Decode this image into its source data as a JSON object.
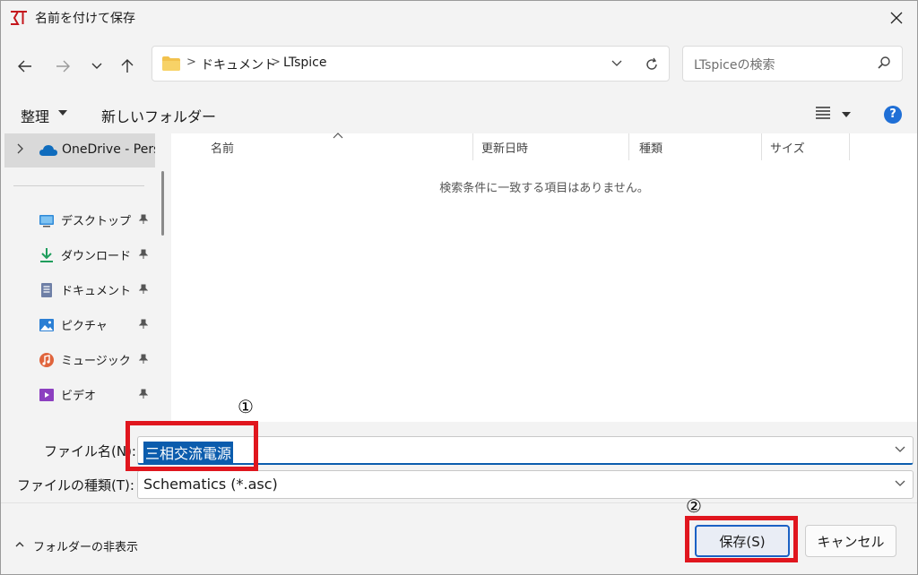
{
  "window": {
    "title": "名前を付けて保存",
    "app_icon": "ltspice-logo-icon"
  },
  "address_bar": {
    "breadcrumbs": [
      "ドキュメント",
      "LTspice"
    ],
    "separator": ">"
  },
  "search": {
    "placeholder": "LTspiceの検索"
  },
  "command_bar": {
    "organize_label": "整理",
    "new_folder_label": "新しいフォルダー"
  },
  "nav_pane": {
    "onedrive_label": "OneDrive - Perso",
    "quick_access": [
      {
        "label": "デスクトップ",
        "icon": "desktop-icon",
        "color": "#2f8ad8"
      },
      {
        "label": "ダウンロード",
        "icon": "download-icon",
        "color": "#1f9d5c"
      },
      {
        "label": "ドキュメント",
        "icon": "document-icon",
        "color": "#6e7fa6"
      },
      {
        "label": "ピクチャ",
        "icon": "pictures-icon",
        "color": "#2b7fd4"
      },
      {
        "label": "ミュージック",
        "icon": "music-icon",
        "color": "#e0643c"
      },
      {
        "label": "ビデオ",
        "icon": "video-icon",
        "color": "#8c3fc0"
      }
    ]
  },
  "file_list": {
    "columns": [
      "名前",
      "更新日時",
      "種類",
      "サイズ"
    ],
    "empty_message": "検索条件に一致する項目はありません。"
  },
  "fields": {
    "filename_label": "ファイル名(N):",
    "filename_value": "三相交流電源",
    "filetype_label": "ファイルの種類(T):",
    "filetype_value": "Schematics (*.asc)"
  },
  "footer": {
    "hide_folders_label": "フォルダーの非表示",
    "save_label": "保存(S)",
    "cancel_label": "キャンセル"
  },
  "annotations": {
    "marker_1": "①",
    "marker_2": "②",
    "color": "#e0161e"
  }
}
